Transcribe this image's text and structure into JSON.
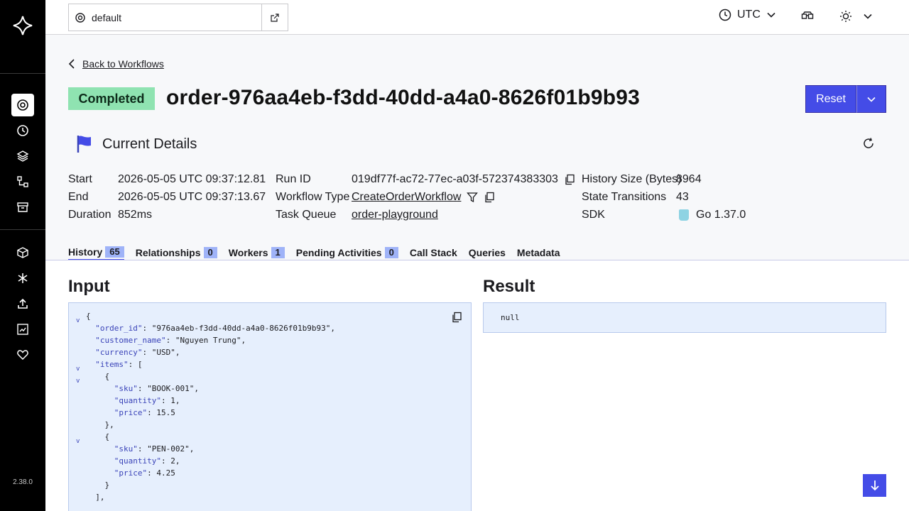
{
  "app": {
    "version": "2.38.0"
  },
  "topbar": {
    "namespace": "default",
    "timezone": "UTC"
  },
  "header": {
    "back_label": "Back to Workflows",
    "status": "Completed",
    "workflow_id": "order-976aa4eb-f3dd-40dd-a4a0-8626f01b9b93",
    "reset_label": "Reset",
    "section_title": "Current Details"
  },
  "details": {
    "start_label": "Start",
    "start_value": "2026-05-05 UTC 09:37:12.81",
    "end_label": "End",
    "end_value": "2026-05-05 UTC 09:37:13.67",
    "duration_label": "Duration",
    "duration_value": "852ms",
    "run_id_label": "Run ID",
    "run_id_value": "019df77f-ac72-77ec-a03f-572374383303",
    "workflow_type_label": "Workflow Type",
    "workflow_type_value": "CreateOrderWorkflow",
    "task_queue_label": "Task Queue",
    "task_queue_value": "order-playground",
    "history_size_label": "History Size (Bytes)",
    "history_size_value": "8964",
    "state_transitions_label": "State Transitions",
    "state_transitions_value": "43",
    "sdk_label": "SDK",
    "sdk_value": "Go 1.37.0"
  },
  "tabs": [
    {
      "label": "History",
      "count": "65"
    },
    {
      "label": "Relationships",
      "count": "0"
    },
    {
      "label": "Workers",
      "count": "1"
    },
    {
      "label": "Pending Activities",
      "count": "0"
    },
    {
      "label": "Call Stack"
    },
    {
      "label": "Queries"
    },
    {
      "label": "Metadata"
    }
  ],
  "input": {
    "title": "Input",
    "lines": [
      "{",
      "  \"order_id\": \"976aa4eb-f3dd-40dd-a4a0-8626f01b9b93\",",
      "  \"customer_name\": \"Nguyen Trung\",",
      "  \"currency\": \"USD\",",
      "  \"items\": [",
      "    {",
      "      \"sku\": \"BOOK-001\",",
      "      \"quantity\": 1,",
      "      \"price\": 15.5",
      "    },",
      "    {",
      "      \"sku\": \"PEN-002\",",
      "      \"quantity\": 2,",
      "      \"price\": 4.25",
      "    }",
      "  ],"
    ]
  },
  "result": {
    "title": "Result",
    "value": "null"
  },
  "colors": {
    "accent": "#444ce7",
    "status_completed": "#8fe3b1",
    "code_bg": "#e6effd"
  }
}
